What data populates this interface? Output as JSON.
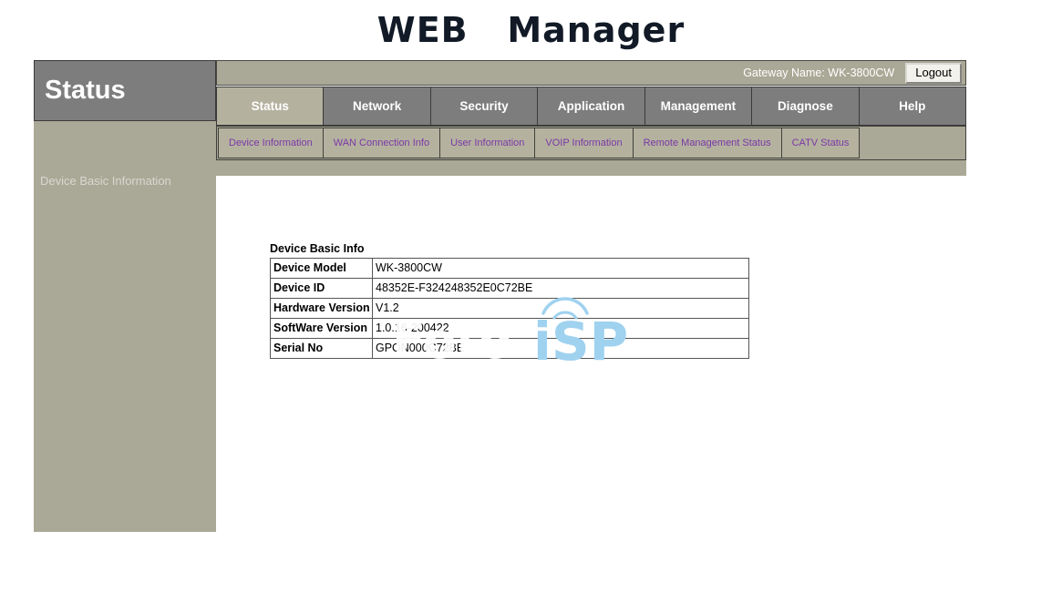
{
  "banner": {
    "title": "WEB   Manager"
  },
  "sidebar": {
    "title": "Status",
    "items": [
      {
        "label": "Device Basic Information"
      }
    ]
  },
  "header": {
    "gateway_label": "Gateway Name: WK-3800CW",
    "logout_label": "Logout"
  },
  "main_tabs": [
    {
      "label": "Status",
      "active": true
    },
    {
      "label": "Network",
      "active": false
    },
    {
      "label": "Security",
      "active": false
    },
    {
      "label": "Application",
      "active": false
    },
    {
      "label": "Management",
      "active": false
    },
    {
      "label": "Diagnose",
      "active": false
    },
    {
      "label": "Help",
      "active": false
    }
  ],
  "sub_tabs": [
    {
      "label": "Device Information"
    },
    {
      "label": "WAN Connection Info"
    },
    {
      "label": "User Information"
    },
    {
      "label": "VOIP Information"
    },
    {
      "label": "Remote Management Status"
    },
    {
      "label": "CATV Status"
    }
  ],
  "content": {
    "table_caption": "Device Basic Info",
    "rows": [
      {
        "label": "Device Model",
        "value": "WK-3800CW"
      },
      {
        "label": "Device ID",
        "value": "48352E-F324248352E0C72BE"
      },
      {
        "label": "Hardware Version",
        "value": "V1.2"
      },
      {
        "label": "SoftWare Version",
        "value": "1.0.16-200422"
      },
      {
        "label": "Serial No",
        "value": "GPON000C72BE"
      }
    ]
  },
  "watermark": {
    "text_left": "Foto",
    "text_right": "iSP"
  },
  "colors": {
    "khaki": "#aaa896",
    "khaki_light": "#b4b29f",
    "gray_tab": "#7d7d7d",
    "link_purple": "#7b37a8",
    "watermark_blue": "#9fd2ef"
  }
}
